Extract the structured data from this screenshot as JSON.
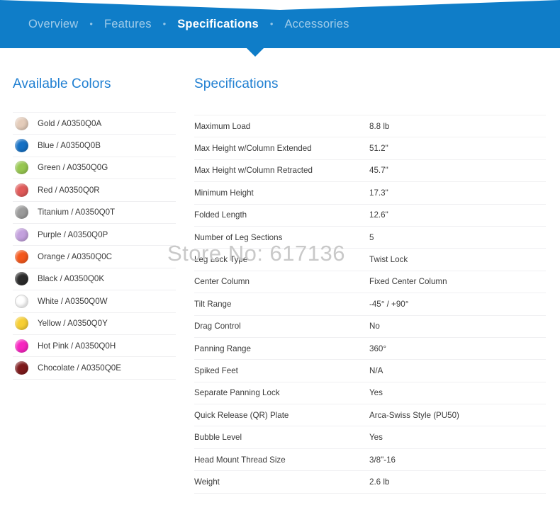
{
  "nav": {
    "separator": "•",
    "items": [
      {
        "label": "Overview",
        "active": false
      },
      {
        "label": "Features",
        "active": false
      },
      {
        "label": "Specifications",
        "active": true
      },
      {
        "label": "Accessories",
        "active": false
      }
    ],
    "background_color": "#0f7dc8",
    "active_text_color": "#ffffff",
    "inactive_text_color": "rgba(255,255,255,0.60)"
  },
  "colors_panel": {
    "title": "Available Colors",
    "title_color": "#2180d2",
    "items": [
      {
        "label": "Gold / A0350Q0A",
        "swatch": "#e4ccba",
        "outlined": false
      },
      {
        "label": "Blue / A0350Q0B",
        "swatch": "#1570c4",
        "outlined": false
      },
      {
        "label": "Green / A0350Q0G",
        "swatch": "#97c750",
        "outlined": false
      },
      {
        "label": "Red / A0350Q0R",
        "swatch": "#e05a59",
        "outlined": false
      },
      {
        "label": "Titanium / A0350Q0T",
        "swatch": "#9b9b9b",
        "outlined": false
      },
      {
        "label": "Purple / A0350Q0P",
        "swatch": "#c3a0dd",
        "outlined": false
      },
      {
        "label": "Orange / A0350Q0C",
        "swatch": "#f4571b",
        "outlined": false
      },
      {
        "label": "Black / A0350Q0K",
        "swatch": "#2b2b2b",
        "outlined": false
      },
      {
        "label": "White / A0350Q0W",
        "swatch": "#ffffff",
        "outlined": true
      },
      {
        "label": "Yellow / A0350Q0Y",
        "swatch": "#f7cf33",
        "outlined": false
      },
      {
        "label": "Hot Pink / A0350Q0H",
        "swatch": "#f724c0",
        "outlined": false
      },
      {
        "label": "Chocolate / A0350Q0E",
        "swatch": "#7e1a1c",
        "outlined": false
      }
    ]
  },
  "specs_panel": {
    "title": "Specifications",
    "title_color": "#2180d2",
    "rows": [
      {
        "key": "Maximum Load",
        "value": "8.8 lb"
      },
      {
        "key": "Max Height w/Column Extended",
        "value": "51.2\""
      },
      {
        "key": "Max Height w/Column Retracted",
        "value": "45.7\""
      },
      {
        "key": "Minimum Height",
        "value": "17.3\""
      },
      {
        "key": "Folded Length",
        "value": "12.6\""
      },
      {
        "key": "Number of Leg Sections",
        "value": "5"
      },
      {
        "key": "Leg Lock Type",
        "value": "Twist Lock"
      },
      {
        "key": "Center Column",
        "value": "Fixed Center Column"
      },
      {
        "key": "Tilt Range",
        "value": "-45° / +90°"
      },
      {
        "key": "Drag Control",
        "value": "No"
      },
      {
        "key": "Panning Range",
        "value": "360°"
      },
      {
        "key": "Spiked Feet",
        "value": "N/A"
      },
      {
        "key": "Separate Panning Lock",
        "value": "Yes"
      },
      {
        "key": "Quick Release (QR) Plate",
        "value": "Arca-Swiss Style (PU50)"
      },
      {
        "key": "Bubble Level",
        "value": "Yes"
      },
      {
        "key": "Head Mount Thread Size",
        "value": "3/8\"-16"
      },
      {
        "key": "Weight",
        "value": "2.6 lb"
      }
    ]
  },
  "watermark": {
    "text": "Store No: 617136",
    "color": "#c9c9c9"
  }
}
